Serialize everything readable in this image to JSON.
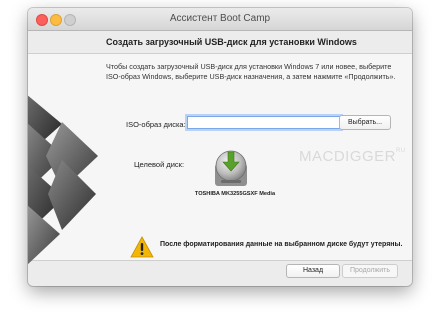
{
  "window": {
    "title": "Ассистент Boot Camp",
    "heading": "Создать загрузочный USB-диск для установки Windows"
  },
  "main": {
    "instructions": "Чтобы создать загрузочный USB-диск для установки Windows 7 или новее, выберите ISO-образ Windows, выберите USB-диск назначения, а затем нажмите «Продолжить».",
    "iso_label": "ISO-образ диска:",
    "iso_value": "",
    "browse_label": "Выбрать...",
    "watermark": "MACDIGGER",
    "watermark_mark": "RU",
    "target_label": "Целевой диск:",
    "disk_name": "TOSHIBA MK3255GSXF Media",
    "warning_text": "После форматирования данные на выбранном диске будут утеряны."
  },
  "footer": {
    "back_label": "Назад",
    "continue_label": "Продолжить"
  },
  "colors": {
    "accent_focus": "#7aa7e8",
    "disk_arrow": "#5aa02c",
    "warning": "#f2b705"
  },
  "icons": {
    "logo": "bootcamp-logo",
    "disk": "external-disk-icon",
    "warning": "warning-icon"
  }
}
